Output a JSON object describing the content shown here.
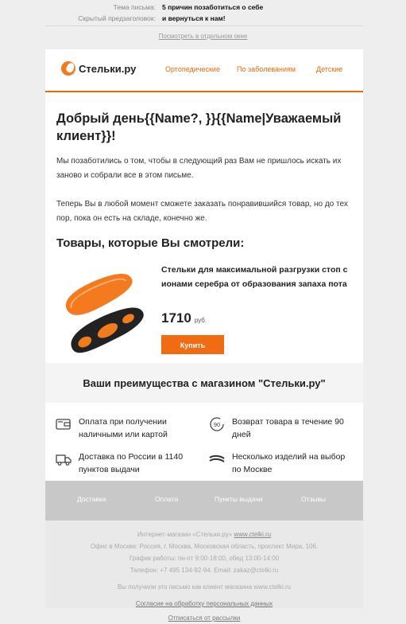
{
  "meta": {
    "subject_label": "Тема письма:",
    "subject_value": "5 причин позаботиться о себе",
    "preheader_label": "Скрытый предзаголовок:",
    "preheader_value": "и вернуться к нам!"
  },
  "browser_link": "Посмотреть в отдельном окне",
  "header": {
    "logo_text": "Стельки.ру",
    "nav": [
      "Ортопедические",
      "По заболеваниям",
      "Детские"
    ]
  },
  "greeting": "Добрый день{{Name?, }}{{Name|Уважаемый клиент}}!",
  "paragraph1": "Мы позаботились о том, чтобы в следующий раз Вам не пришлось искать их заново и собрали все в этом письме.",
  "paragraph2": "Теперь Вы в любой момент сможете заказать понравившийся товар, но до тех пор, пока он есть на складе, конечно же.",
  "viewed_title": "Товары, которые Вы смотрели:",
  "product": {
    "name": "Стельки для максимальной разгрузки стоп с ионами серебра от образования запаха пота",
    "price": "1710",
    "currency": "руб.",
    "buy_label": "Купить"
  },
  "advantages": {
    "title": "Ваши преимущества с магазином \"Стельки.ру\"",
    "items": [
      {
        "icon": "wallet-icon",
        "text": "Оплата при получении наличными или картой"
      },
      {
        "icon": "return-90-icon",
        "text": "Возврат товара в течение 90 дней"
      },
      {
        "icon": "truck-icon",
        "text": "Доставка по России в 1140 пунктов выдачи"
      },
      {
        "icon": "insoles-icon",
        "text": "Несколько изделий на выбор по Москве"
      }
    ]
  },
  "footer_nav": [
    "Доставка",
    "Оплата",
    "Пункты выдачи",
    "Отзывы"
  ],
  "footer": {
    "shop": "Интернет-магазин «Стельки.ру»",
    "site": "www.ctelki.ru",
    "office": "Офис в Москве: Россия, г. Москва, Московская область, проспект Мира, 106.",
    "hours": "График работы: пн-пт 9:00-18:00, обед 13:00-14:00",
    "contacts": "Телефон: +7 495 134-92-94. Email: zakaz@ctelki.ru",
    "client_note": "Вы получили это письмо как клиент магазина www.ctelki.ru",
    "consent": "Согласие на обработку персональных данных",
    "unsubscribe": "Отписаться от рассылки"
  },
  "colors": {
    "accent": "#f06b12",
    "nav": "#e46c0a"
  }
}
